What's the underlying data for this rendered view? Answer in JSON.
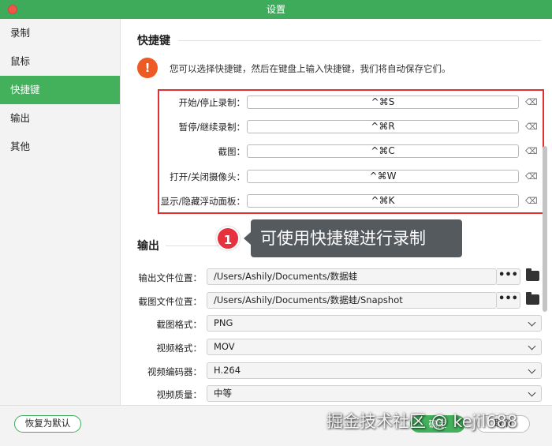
{
  "window": {
    "title": "设置"
  },
  "sidebar": {
    "items": [
      {
        "label": "录制"
      },
      {
        "label": "鼠标"
      },
      {
        "label": "快捷键"
      },
      {
        "label": "输出"
      },
      {
        "label": "其他"
      }
    ],
    "active_index": 2
  },
  "shortcuts": {
    "section_title": "快捷键",
    "info_icon": "!",
    "info_text": "您可以选择快捷键，然后在键盘上输入快捷键，我们将自动保存它们。",
    "clear_icon": "⌫",
    "rows": [
      {
        "label": "开始/停止录制：",
        "value": "^⌘S"
      },
      {
        "label": "暂停/继续录制：",
        "value": "^⌘R"
      },
      {
        "label": "截图：",
        "value": "^⌘C"
      },
      {
        "label": "打开/关闭摄像头：",
        "value": "^⌘W"
      },
      {
        "label": "显示/隐藏浮动面板：",
        "value": "^⌘K"
      }
    ]
  },
  "annotation": {
    "badge": "1",
    "text": "可使用快捷键进行录制"
  },
  "output": {
    "section_title": "输出",
    "dots_label": "•••",
    "output_location": {
      "label": "输出文件位置：",
      "value": "/Users/Ashily/Documents/数据蛙"
    },
    "screenshot_location": {
      "label": "截图文件位置：",
      "value": "/Users/Ashily/Documents/数据蛙/Snapshot"
    },
    "screenshot_format": {
      "label": "截图格式：",
      "value": "PNG"
    },
    "video_format": {
      "label": "视频格式：",
      "value": "MOV"
    },
    "video_encoder": {
      "label": "视频编码器：",
      "value": "H.264"
    },
    "video_quality": {
      "label": "视频质量：",
      "value": "中等"
    }
  },
  "footer": {
    "reset_label": "恢复为默认",
    "ok_label": "确定",
    "cancel_label": "取消"
  },
  "watermark": "掘金技术社区 @ kejil688",
  "colors": {
    "accent": "#43b05c",
    "titlebar": "#3dab5a",
    "highlight_border": "#e03030",
    "warning": "#ee5a24",
    "badge": "#e5323e",
    "tooltip_bg": "#555a5e"
  }
}
